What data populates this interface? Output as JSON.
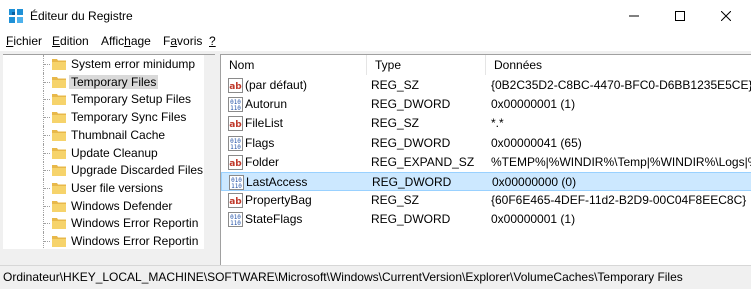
{
  "window": {
    "title": "Éditeur du Registre"
  },
  "menu": [
    {
      "pre": "",
      "u": "F",
      "post": "ichier"
    },
    {
      "pre": "",
      "u": "E",
      "post": "dition"
    },
    {
      "pre": "Affic",
      "u": "h",
      "post": "age"
    },
    {
      "pre": "F",
      "u": "a",
      "post": "voris"
    },
    {
      "pre": "",
      "u": "?",
      "post": ""
    }
  ],
  "tree": {
    "items": [
      {
        "label": "System error minidump"
      },
      {
        "label": "Temporary Files",
        "selected": true
      },
      {
        "label": "Temporary Setup Files"
      },
      {
        "label": "Temporary Sync Files"
      },
      {
        "label": "Thumbnail Cache"
      },
      {
        "label": "Update Cleanup"
      },
      {
        "label": "Upgrade Discarded Files"
      },
      {
        "label": "User file versions"
      },
      {
        "label": "Windows Defender"
      },
      {
        "label": "Windows Error Reportin"
      },
      {
        "label": "Windows Error Reportin"
      }
    ]
  },
  "columns": {
    "name": "Nom",
    "type": "Type",
    "data": "Données"
  },
  "values": [
    {
      "icon": "string-value-icon",
      "name": "(par défaut)",
      "type": "REG_SZ",
      "data": "{0B2C35D2-C8BC-4470-BFC0-D6BB1235E5CE}"
    },
    {
      "icon": "binary-value-icon",
      "name": "Autorun",
      "type": "REG_DWORD",
      "data": "0x00000001 (1)"
    },
    {
      "icon": "string-value-icon",
      "name": "FileList",
      "type": "REG_SZ",
      "data": "*.*"
    },
    {
      "icon": "binary-value-icon",
      "name": "Flags",
      "type": "REG_DWORD",
      "data": "0x00000041 (65)"
    },
    {
      "icon": "string-value-icon",
      "name": "Folder",
      "type": "REG_EXPAND_SZ",
      "data": "%TEMP%|%WINDIR%\\Temp|%WINDIR%\\Logs|%W"
    },
    {
      "icon": "binary-value-icon",
      "name": "LastAccess",
      "type": "REG_DWORD",
      "data": "0x00000000 (0)",
      "selected": true
    },
    {
      "icon": "string-value-icon",
      "name": "PropertyBag",
      "type": "REG_SZ",
      "data": "{60F6E465-4DEF-11d2-B2D9-00C04F8EEC8C}"
    },
    {
      "icon": "binary-value-icon",
      "name": "StateFlags",
      "type": "REG_DWORD",
      "data": "0x00000001 (1)"
    }
  ],
  "status": {
    "path": "Ordinateur\\HKEY_LOCAL_MACHINE\\SOFTWARE\\Microsoft\\Windows\\CurrentVersion\\Explorer\\VolumeCaches\\Temporary Files"
  }
}
